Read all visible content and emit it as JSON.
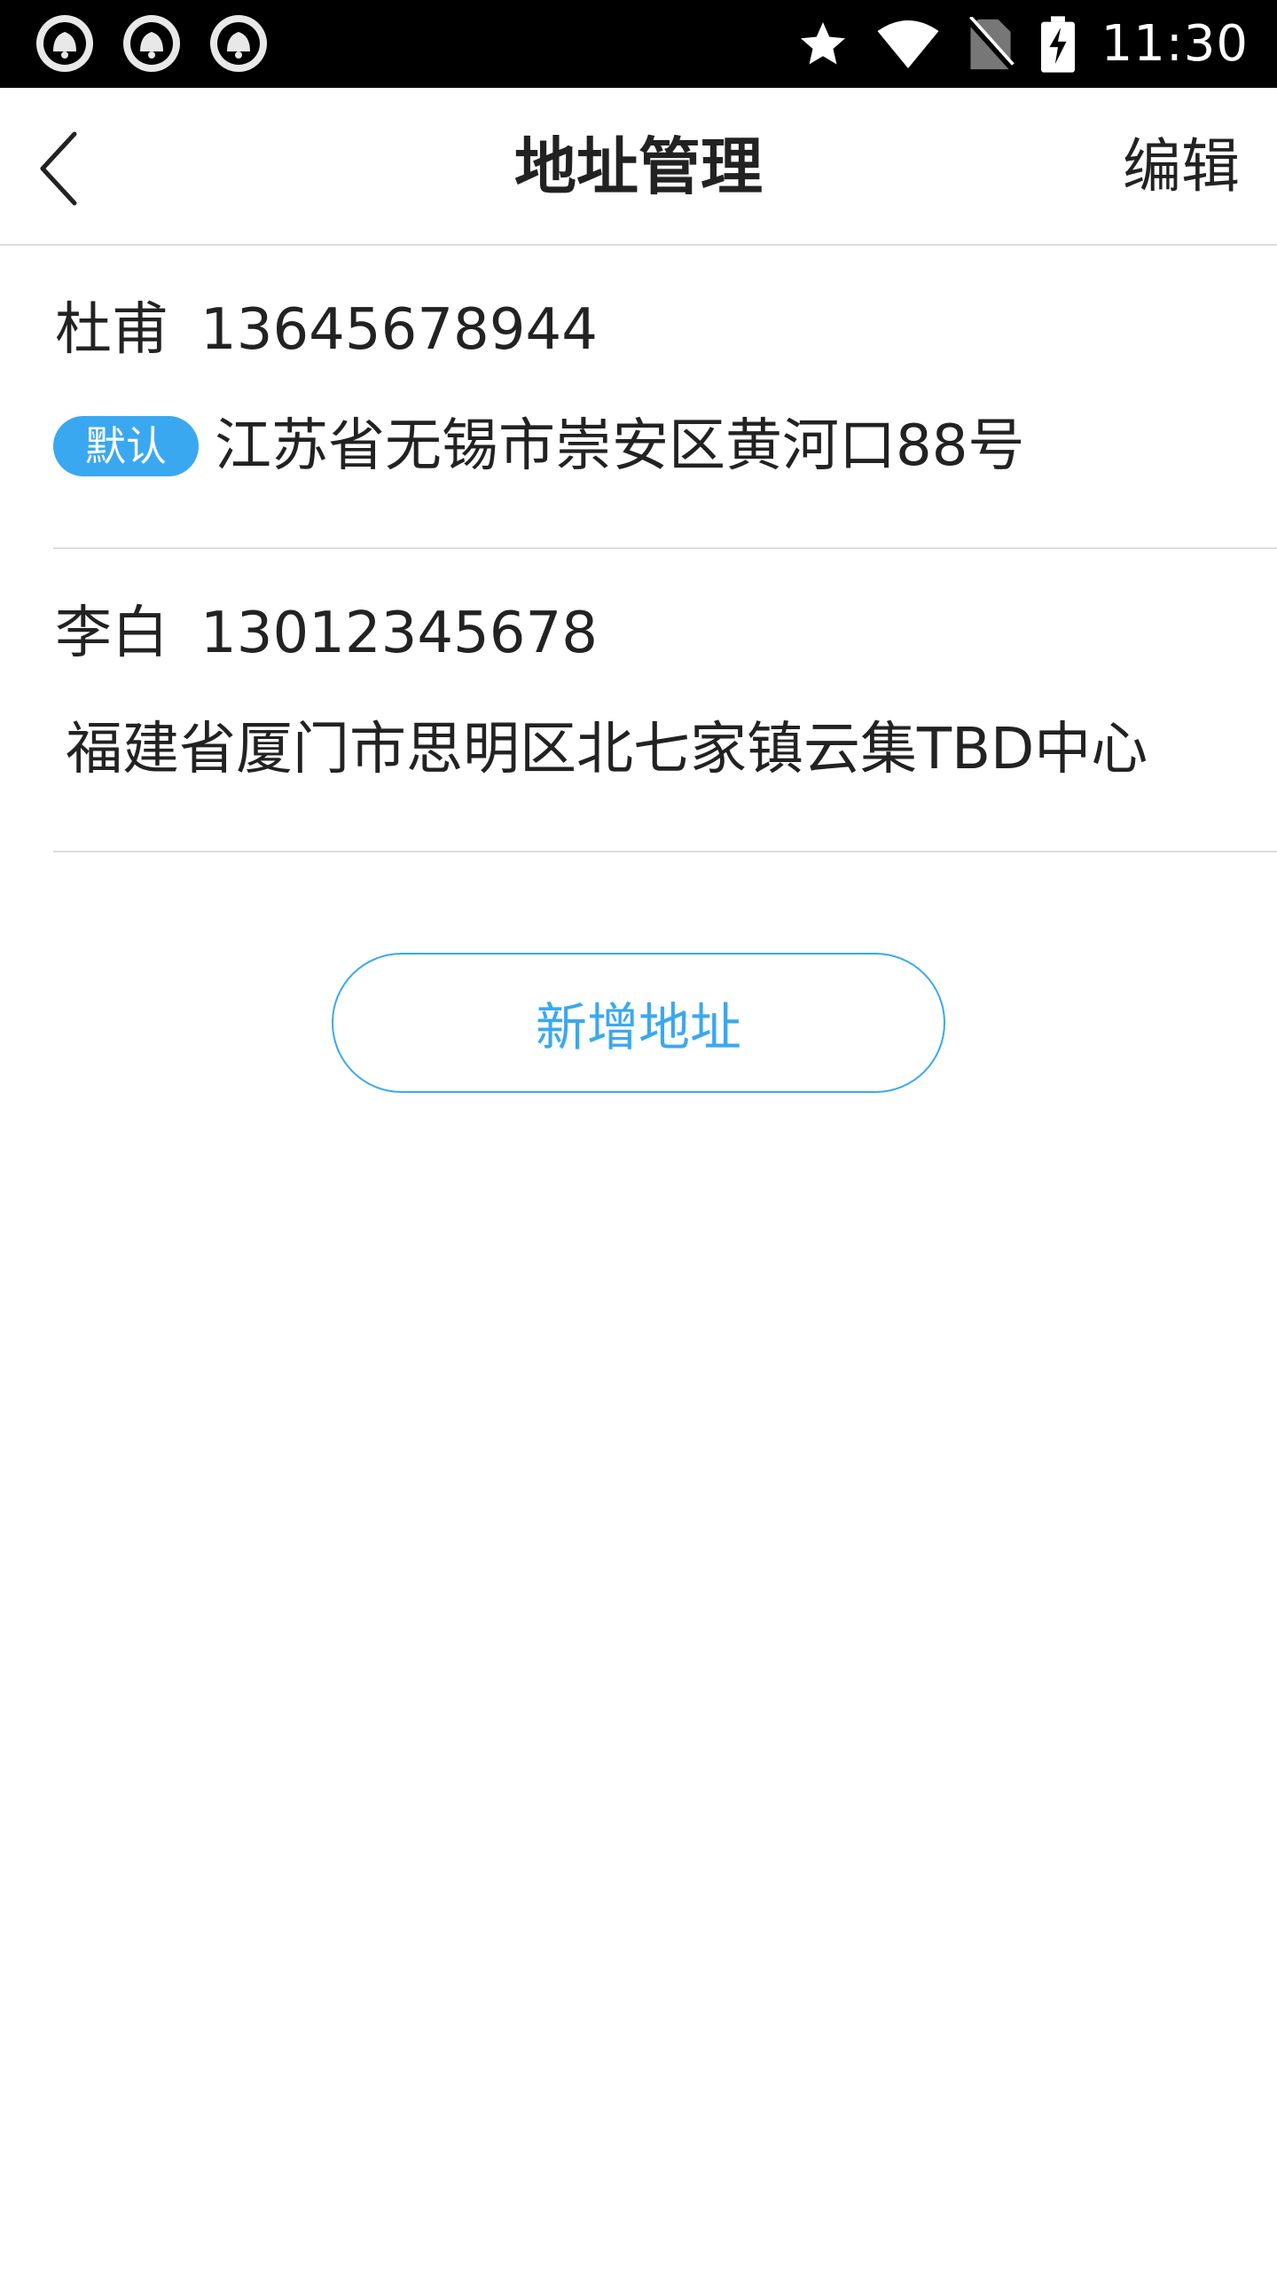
{
  "status_bar": {
    "time": "11:30",
    "notification_icons": [
      "app-notification-icon",
      "app-notification-icon",
      "app-notification-icon"
    ],
    "right_icons": [
      "star-icon",
      "wifi-icon",
      "no-sim-icon",
      "battery-charging-icon"
    ]
  },
  "header": {
    "title": "地址管理",
    "edit_label": "编辑",
    "back_icon": "chevron-left-icon"
  },
  "addresses": [
    {
      "name": "杜甫",
      "phone": "13645678944",
      "is_default": true,
      "default_label": "默认",
      "address": "江苏省无锡市崇安区黄河口88号"
    },
    {
      "name": "李白",
      "phone": "13012345678",
      "is_default": false,
      "address": "福建省厦门市思明区北七家镇云集TBD中心"
    }
  ],
  "add_button_label": "新增地址",
  "colors": {
    "accent": "#3aa8f0",
    "text": "#222222",
    "divider": "#dddddd",
    "status_bar_bg": "#000000"
  }
}
